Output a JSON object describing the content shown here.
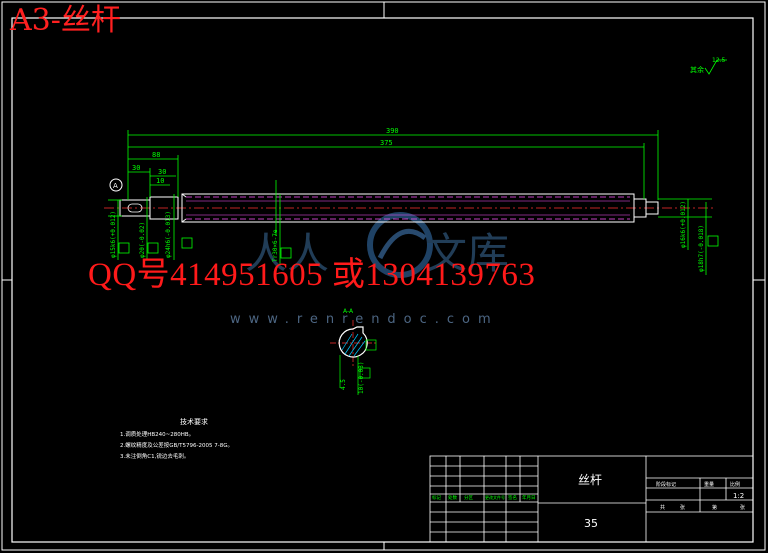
{
  "header": {
    "title": "A3-丝杆"
  },
  "watermark": {
    "contact": "QQ号414951605 或1304139763",
    "url": "www.renrendoc.com",
    "logo_glyphs": "人人文库"
  },
  "drawing": {
    "dim_overall": "390",
    "dim_second": "375",
    "dim_a": "88",
    "dim_b": "30",
    "dim_c": "30",
    "dim_d": "10",
    "section_label": "A-A",
    "surface_mark": "12.5",
    "surface_mark_note": "其余",
    "view_marker": "A"
  },
  "notes": {
    "heading": "技术要求",
    "lines": [
      "1.调质处理HB240~280HB。",
      "2.螺纹精度及公差按GB/T5796-2005 7-8G。",
      "3.未注倒角C1,锐边去毛刺。"
    ]
  },
  "title_block": {
    "part_name": "丝杆",
    "material": "35",
    "scale": "1:2",
    "cells_small": [
      "标记",
      "处数",
      "分区",
      "更改文件号",
      "签名",
      "年月日"
    ],
    "right_labels": [
      "阶段标记",
      "重量",
      "比例"
    ],
    "bottom_labels": [
      "共",
      "张",
      "第",
      "张"
    ]
  },
  "colors": {
    "frame": "#ffffff",
    "dimension": "#00ff00",
    "geometry": "#ff55ff",
    "centerline": "#ff3030",
    "hatch": "#00c8ff",
    "title_red": "#ff2020"
  }
}
